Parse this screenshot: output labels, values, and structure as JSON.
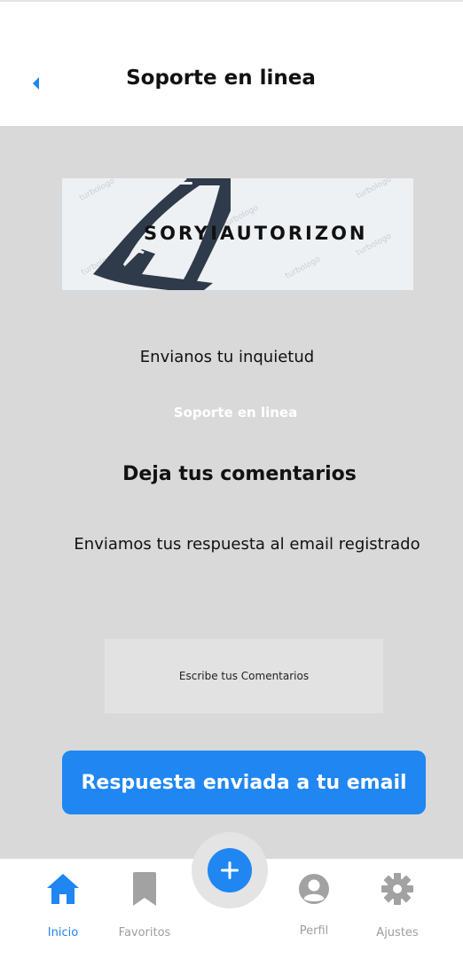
{
  "header": {
    "title": "Soporte en linea",
    "back_icon": "chevron-left-icon"
  },
  "logo": {
    "text": "SORYIAUTORIZON",
    "watermark": "turbologo"
  },
  "main": {
    "prompt": "Envianos tu inquietud",
    "subtitle": "Soporte en linea",
    "heading": "Deja tus comentarios",
    "info": "Enviamos tus respuesta al email registrado",
    "comment_placeholder": "Escribe tus Comentarios",
    "submit_label": "Respuesta enviada a tu email"
  },
  "tabs": [
    {
      "label": "Inicio",
      "icon": "home-icon",
      "active": true
    },
    {
      "label": "Favoritos",
      "icon": "bookmark-icon",
      "active": false
    },
    {
      "label": "Perfil",
      "icon": "user-icon",
      "active": false
    },
    {
      "label": "Ajustes",
      "icon": "gear-icon",
      "active": false
    }
  ],
  "fab": {
    "icon": "plus-icon"
  },
  "colors": {
    "accent": "#1f86f2",
    "background": "#d9d9d9",
    "header": "#ffffff",
    "inactive": "#9e9e9e"
  }
}
